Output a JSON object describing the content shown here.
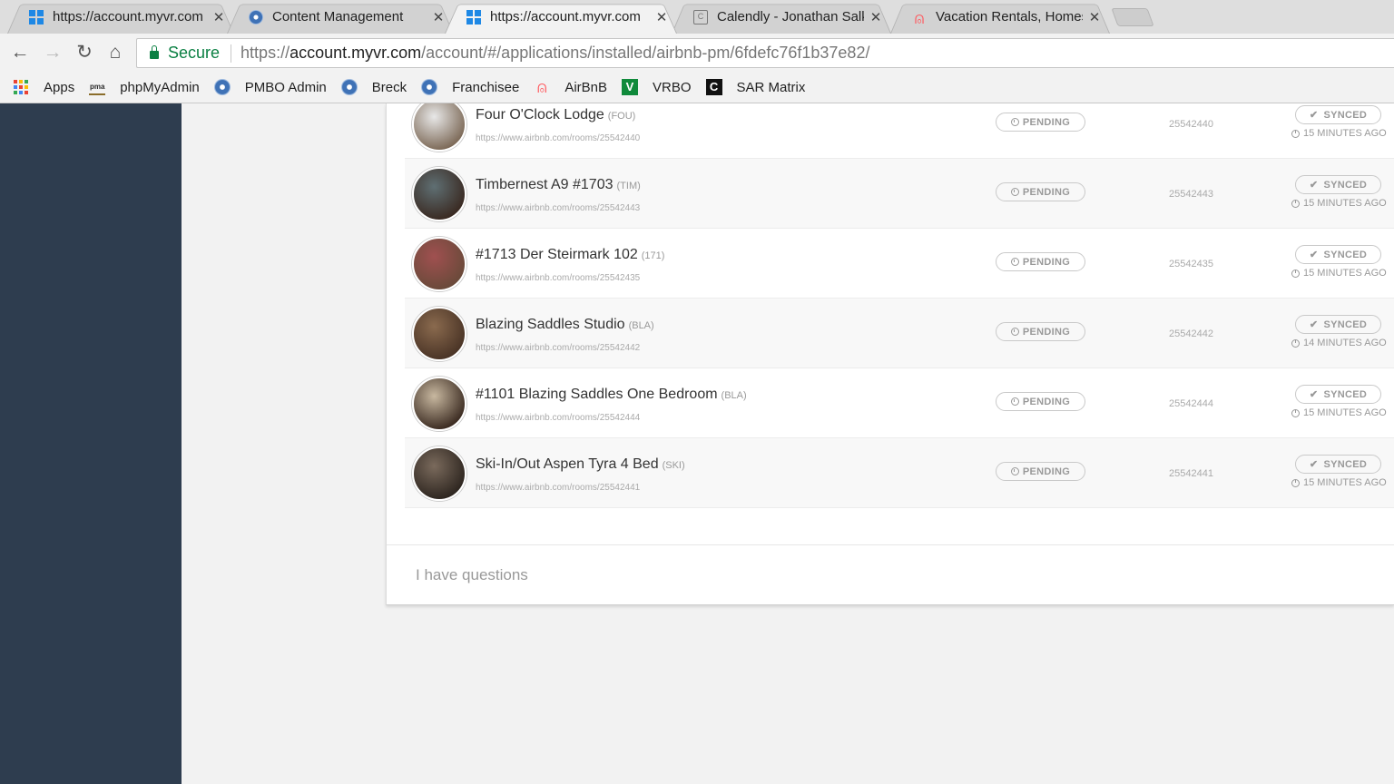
{
  "browser": {
    "tabs": [
      {
        "title": "https://account.myvr.com",
        "icon": "myvr-icon",
        "active": false
      },
      {
        "title": "Content Management",
        "icon": "pmbo-gear-icon",
        "active": false
      },
      {
        "title": "https://account.myvr.com",
        "icon": "myvr-icon",
        "active": true
      },
      {
        "title": "Calendly - Jonathan Salkc",
        "icon": "calendly-icon",
        "active": false
      },
      {
        "title": "Vacation Rentals, Homes,",
        "icon": "airbnb-icon",
        "active": false
      }
    ],
    "close_glyph": "✕",
    "secure_label": "Secure",
    "url_scheme": "https://",
    "url_host": "account.myvr.com",
    "url_path": "/account/#/applications/installed/airbnb-pm/6fdefc76f1b37e82/",
    "nav": {
      "back": "←",
      "forward": "→",
      "reload": "↻",
      "home": "⌂"
    },
    "bookmarks": [
      {
        "label": "Apps",
        "icon": "apps-grid-icon"
      },
      {
        "label": "phpMyAdmin",
        "icon": "phpmyadmin-icon"
      },
      {
        "label": "PMBO Admin",
        "icon": "pmbo-gear-icon"
      },
      {
        "label": "Breck",
        "icon": "pmbo-gear-icon"
      },
      {
        "label": "Franchisee",
        "icon": "pmbo-gear-icon"
      },
      {
        "label": "AirBnB",
        "icon": "airbnb-icon"
      },
      {
        "label": "VRBO",
        "icon": "vrbo-icon"
      },
      {
        "label": "SAR Matrix",
        "icon": "sar-matrix-icon"
      }
    ]
  },
  "listings": [
    {
      "name": "Four O'Clock Lodge",
      "code": "(FOU)",
      "url": "https://www.airbnb.com/rooms/25542440",
      "status": "PENDING",
      "id": "25542440",
      "sync": "SYNCED",
      "ago": "15 MINUTES AGO",
      "thumb_colors": [
        "#e8e8e8",
        "#7d6a58"
      ]
    },
    {
      "name": "Timbernest A9 #1703",
      "code": "(TIM)",
      "url": "https://www.airbnb.com/rooms/25542443",
      "status": "PENDING",
      "id": "25542443",
      "sync": "SYNCED",
      "ago": "15 MINUTES AGO",
      "thumb_colors": [
        "#5f6f73",
        "#3a2a22"
      ]
    },
    {
      "name": "#1713 Der Steirmark 102",
      "code": "(171)",
      "url": "https://www.airbnb.com/rooms/25542435",
      "status": "PENDING",
      "id": "25542435",
      "sync": "SYNCED",
      "ago": "15 MINUTES AGO",
      "thumb_colors": [
        "#a05050",
        "#6a4a3a"
      ]
    },
    {
      "name": "Blazing Saddles Studio",
      "code": "(BLA)",
      "url": "https://www.airbnb.com/rooms/25542442",
      "status": "PENDING",
      "id": "25542442",
      "sync": "SYNCED",
      "ago": "14 MINUTES AGO",
      "thumb_colors": [
        "#8a6a4e",
        "#4a3426"
      ]
    },
    {
      "name": "#1101 Blazing Saddles One Bedroom",
      "code": "(BLA)",
      "url": "https://www.airbnb.com/rooms/25542444",
      "status": "PENDING",
      "id": "25542444",
      "sync": "SYNCED",
      "ago": "15 MINUTES AGO",
      "thumb_colors": [
        "#c8b8a0",
        "#3c2c22"
      ]
    },
    {
      "name": "Ski-In/Out Aspen Tyra 4 Bed",
      "code": "(SKI)",
      "url": "https://www.airbnb.com/rooms/25542441",
      "status": "PENDING",
      "id": "25542441",
      "sync": "SYNCED",
      "ago": "15 MINUTES AGO",
      "thumb_colors": [
        "#7a6a5c",
        "#2e2620"
      ]
    }
  ],
  "footer": {
    "questions_label": "I have questions"
  },
  "colors": {
    "sidebar": "#2e3d4f",
    "secure_green": "#0b8043",
    "airbnb": "#ff5a5f",
    "vrbo": "#108a3b"
  }
}
